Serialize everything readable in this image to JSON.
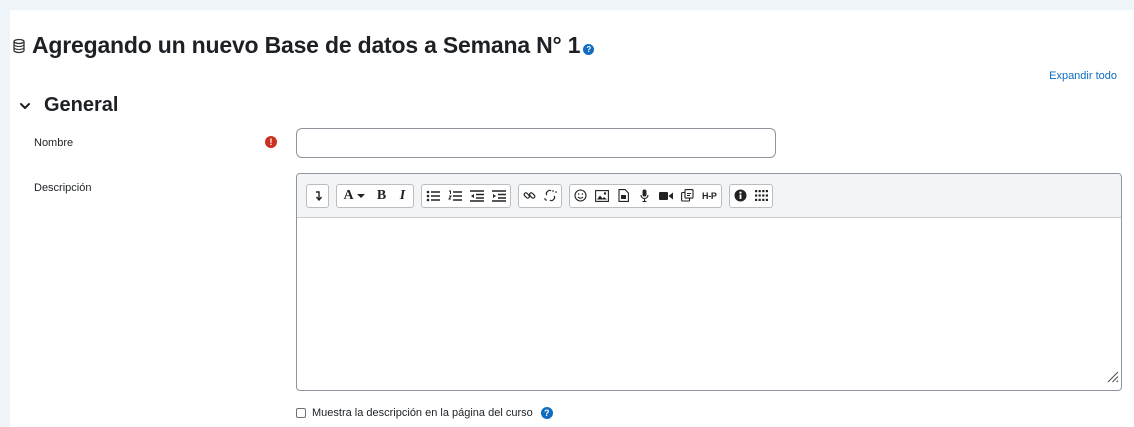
{
  "header": {
    "title": "Agregando un nuevo Base de datos a Semana N° 1",
    "title_icon": "database-icon",
    "help_icon_glyph": "?"
  },
  "expand_all_label": "Expandir todo",
  "section": {
    "title": "General",
    "icon": "chevron-down-icon"
  },
  "form": {
    "name_label": "Nombre",
    "name_value": "",
    "required_icon_glyph": "!",
    "description_label": "Descripción",
    "show_description_label": "Muestra la descripción en la página del curso",
    "show_description_checked": false,
    "help_icon_glyph": "?"
  },
  "toolbar": {
    "groups": [
      [
        "collapse-icon"
      ],
      [
        "font-color-icon",
        "bold-icon",
        "italic-icon"
      ],
      [
        "unordered-list-icon",
        "ordered-list-icon",
        "outdent-icon",
        "indent-icon"
      ],
      [
        "link-icon",
        "unlink-icon"
      ],
      [
        "emoji-icon",
        "image-icon",
        "media-icon",
        "record-audio-icon",
        "record-video-icon",
        "manage-files-icon",
        "h5p-icon"
      ],
      [
        "accessibility-checker-icon",
        "screenreader-helper-icon"
      ]
    ],
    "font_color_label": "A",
    "bold_label": "B",
    "italic_label": "I",
    "h5p_label": "H-P"
  },
  "colors": {
    "accent": "#0f6cbf",
    "required": "#ca3120",
    "text": "#1d2125",
    "border": "#8f959e",
    "toolbar_bg": "#f3f4f5"
  }
}
